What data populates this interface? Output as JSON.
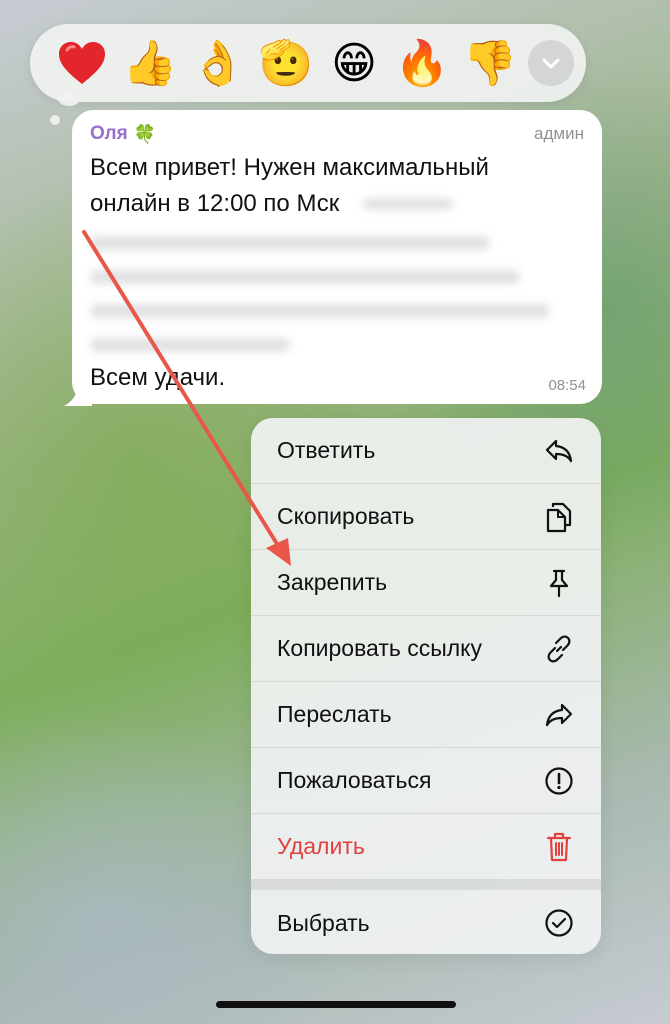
{
  "reactions": {
    "items": [
      {
        "name": "heart",
        "glyph": "❤"
      },
      {
        "name": "thumbs-up",
        "glyph": "👍"
      },
      {
        "name": "ok-hand",
        "glyph": "👌"
      },
      {
        "name": "saluting-face",
        "glyph": "🫡"
      },
      {
        "name": "grinning-face",
        "glyph": "😁"
      },
      {
        "name": "fire",
        "glyph": "🔥"
      },
      {
        "name": "thumbs-down",
        "glyph": "👎"
      }
    ],
    "more_icon": "chevron-down-icon"
  },
  "message": {
    "sender": "Оля",
    "sender_emoji": "🍀",
    "role": "админ",
    "text_line1": "Всем привет! Нужен максимальный",
    "text_line2": "онлайн в 12:00 по Мск",
    "closing": "Всем удачи.",
    "time": "08:54"
  },
  "menu": {
    "items": [
      {
        "label": "Ответить",
        "icon": "reply-icon"
      },
      {
        "label": "Скопировать",
        "icon": "copy-icon"
      },
      {
        "label": "Закрепить",
        "icon": "pin-icon"
      },
      {
        "label": "Копировать ссылку",
        "icon": "link-icon"
      },
      {
        "label": "Переслать",
        "icon": "forward-icon"
      },
      {
        "label": "Пожаловаться",
        "icon": "report-icon"
      },
      {
        "label": "Удалить",
        "icon": "trash-icon"
      }
    ],
    "select": {
      "label": "Выбрать",
      "icon": "check-circle-icon"
    }
  },
  "colors": {
    "accent_sender": "#9a6fc9",
    "danger": "#e0413e",
    "annotation_arrow": "#e8574a"
  }
}
